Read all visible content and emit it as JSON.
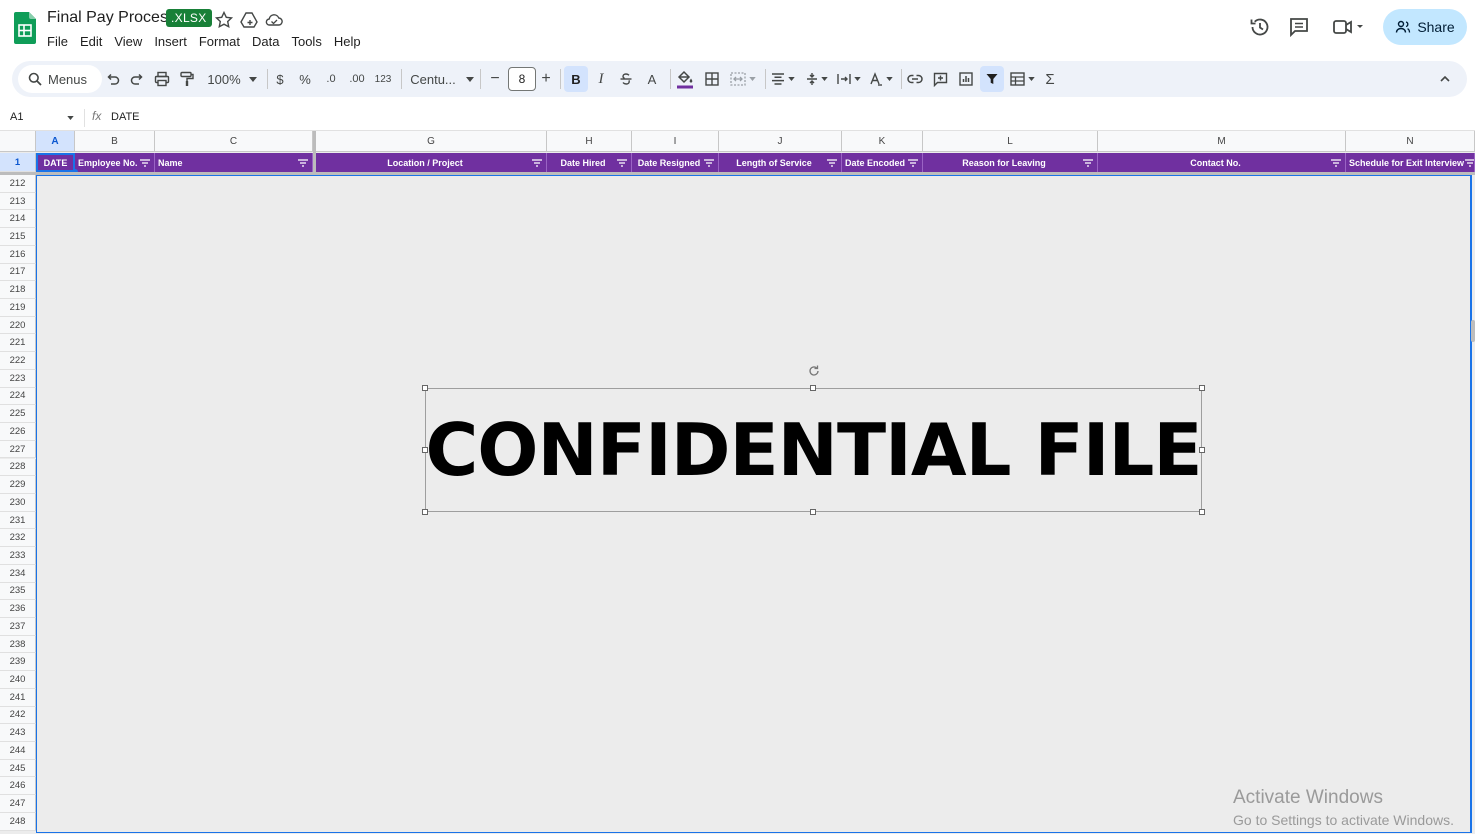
{
  "document": {
    "title": "Final Pay Process",
    "format_badge": ".XLSX"
  },
  "menu": [
    "File",
    "Edit",
    "View",
    "Insert",
    "Format",
    "Data",
    "Tools",
    "Help"
  ],
  "share_label": "Share",
  "toolbar": {
    "search_label": "Menus",
    "zoom": "100%",
    "currency": "$",
    "percent": "%",
    "dec_decrease": ".0",
    "dec_increase": ".00",
    "number_format": "123",
    "font": "Centu...",
    "font_size": "8",
    "minus": "−",
    "plus": "+",
    "bold": "B",
    "italic": "I",
    "text_color_glyph": "A",
    "sum": "Σ"
  },
  "formula_bar": {
    "cell_ref": "A1",
    "fx": "fx",
    "content": "DATE"
  },
  "columns": [
    {
      "letter": "A",
      "selected": true
    },
    {
      "letter": "B",
      "selected": false
    },
    {
      "letter": "C",
      "selected": false
    },
    {
      "letter": "G",
      "selected": false
    },
    {
      "letter": "H",
      "selected": false
    },
    {
      "letter": "I",
      "selected": false
    },
    {
      "letter": "J",
      "selected": false
    },
    {
      "letter": "K",
      "selected": false
    },
    {
      "letter": "L",
      "selected": false
    },
    {
      "letter": "M",
      "selected": false
    },
    {
      "letter": "N",
      "selected": false
    }
  ],
  "header_row_number": "1",
  "header_cells": [
    "DATE",
    "Employee No.",
    "Name",
    "Location / Project",
    "Date Hired",
    "Date Resigned",
    "Length of Service",
    "Date Encoded",
    "Reason for Leaving",
    "Contact No.",
    "Schedule for Exit Interview"
  ],
  "row_numbers": [
    "212",
    "213",
    "214",
    "215",
    "216",
    "217",
    "218",
    "219",
    "220",
    "221",
    "222",
    "223",
    "224",
    "225",
    "226",
    "227",
    "228",
    "229",
    "230",
    "231",
    "232",
    "233",
    "234",
    "235",
    "236",
    "237",
    "238",
    "239",
    "240",
    "241",
    "242",
    "243",
    "244",
    "245",
    "246",
    "247",
    "248"
  ],
  "drawing_text": "CONFIDENTIAL FILE",
  "watermark": {
    "line1": "Activate Windows",
    "line2": "Go to Settings to activate Windows."
  },
  "colors": {
    "header_fill": "#7030a0",
    "badge": "#188038",
    "share": "#c2e7ff",
    "selection": "#1a73e8"
  }
}
